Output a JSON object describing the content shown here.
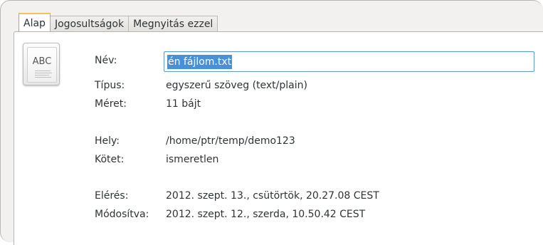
{
  "tabs": [
    {
      "label": "Alap",
      "active": true
    },
    {
      "label": "Jogosultságok",
      "active": false
    },
    {
      "label": "Megnyitás ezzel",
      "active": false
    }
  ],
  "file_icon": {
    "text": "ABC",
    "icon": "text-file-icon"
  },
  "fields": {
    "name_label": "Név:",
    "name_value": "én fájlom.txt",
    "type_label": "Típus:",
    "type_value": "egyszerű szöveg (text/plain)",
    "size_label": "Méret:",
    "size_value": "11 bájt",
    "location_label": "Hely:",
    "location_value": "/home/ptr/temp/demo123",
    "volume_label": "Kötet:",
    "volume_value": "ismeretlen",
    "accessed_label": "Elérés:",
    "accessed_value": "2012. szept. 13., csütörtök, 20.27.08 CEST",
    "modified_label": "Módosítva:",
    "modified_value": "2012. szept. 12., szerda, 10.50.42 CEST"
  },
  "colors": {
    "active_tab_accent": "#f0c35e",
    "selection": "#4a90d9",
    "input_focus_border": "#5e9bd4"
  }
}
